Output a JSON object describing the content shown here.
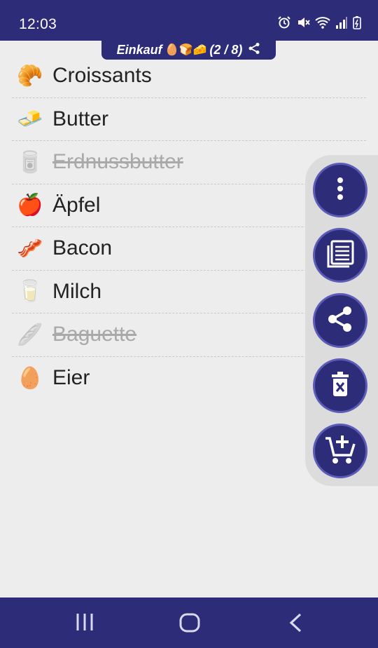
{
  "status_bar": {
    "time": "12:03",
    "icons": [
      "alarm-icon",
      "mute-icon",
      "wifi-icon",
      "signal-icon",
      "battery-icon"
    ]
  },
  "header": {
    "title": "Einkauf",
    "emojis": "🥚🍞🧀",
    "count": "(2 / 8)"
  },
  "items": [
    {
      "label": "Croissants",
      "icon": "🥐",
      "done": false
    },
    {
      "label": "Butter",
      "icon": "🧈",
      "done": false
    },
    {
      "label": "Erdnussbutter",
      "icon": "🥫",
      "done": true
    },
    {
      "label": "Äpfel",
      "icon": "🍎",
      "done": false
    },
    {
      "label": "Bacon",
      "icon": "🥓",
      "done": false
    },
    {
      "label": "Milch",
      "icon": "🥛",
      "done": false
    },
    {
      "label": "Baguette",
      "icon": "🥖",
      "done": true
    },
    {
      "label": "Eier",
      "icon": "🥚",
      "done": false
    }
  ],
  "fab_actions": [
    "more-icon",
    "list-icon",
    "share-icon",
    "delete-icon",
    "add-to-cart-icon"
  ],
  "colors": {
    "primary": "#2c2c78",
    "fab_border": "#5b5bb8",
    "background": "#ededed",
    "done_text": "#a9a9a9"
  }
}
